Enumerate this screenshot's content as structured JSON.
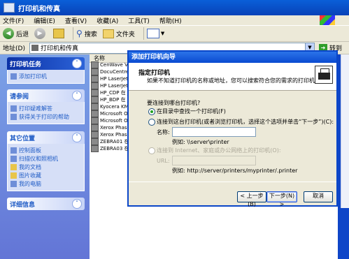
{
  "window": {
    "title": "打印机和传真",
    "menu": [
      "文件(F)",
      "编辑(E)",
      "查看(V)",
      "收藏(A)",
      "工具(T)",
      "帮助(H)"
    ]
  },
  "toolbar": {
    "back_label": "后退",
    "search_label": "搜索",
    "folders_label": "文件夹"
  },
  "address": {
    "label": "地址(D)",
    "value": "打印机和传真",
    "go_label": "转到"
  },
  "sidebar": {
    "printer_tasks": {
      "title": "打印机任务",
      "items": [
        "添加打印机"
      ]
    },
    "see_also": {
      "title": "请参阅",
      "items": [
        "打印疑难解答",
        "获得关于打印的帮助"
      ]
    },
    "other_places": {
      "title": "其它位置",
      "items": [
        "控制面板",
        "扫描仪和照相机",
        "我的文档",
        "图片收藏",
        "我的电脑"
      ]
    },
    "details": {
      "title": "详细信息"
    }
  },
  "file_list": {
    "column_name": "名称",
    "items": [
      "CenWave Vir",
      "DocuCentre-",
      "HP LaserJet",
      "HP LaserJet",
      "HP_CDP 在 j",
      "HP_BDP 在 j",
      "Kyocera KM-",
      "Microsoft O",
      "Microsoft O",
      "Xerox Phase",
      "Xerox Phase",
      "ZEBRA01 在",
      "ZEBRA03 在"
    ]
  },
  "wizard": {
    "title": "添加打印机向导",
    "header_title": "指定打印机",
    "header_subtitle": "如果不知道打印机的名称或地址，您可以搜索符合您的需求的打印机。",
    "question": "要连接到哪台打印机?",
    "option_find": "在目录中查找一个打印机(F)",
    "option_connect": "连接到这台打印机(或者浏览打印机，选择这个选项并单击“下一步”)(C):",
    "name_label": "名称:",
    "name_example": "例如: \\\\server\\printer",
    "option_internet": "连接到 Internet、家庭或办公网络上的打印机(O):",
    "url_label": "URL:",
    "url_example": "例如: http://server/printers/myprinter/.printer",
    "buttons": {
      "back": "< 上一步(B)",
      "next": "下一步(N) >",
      "cancel": "取消"
    }
  }
}
